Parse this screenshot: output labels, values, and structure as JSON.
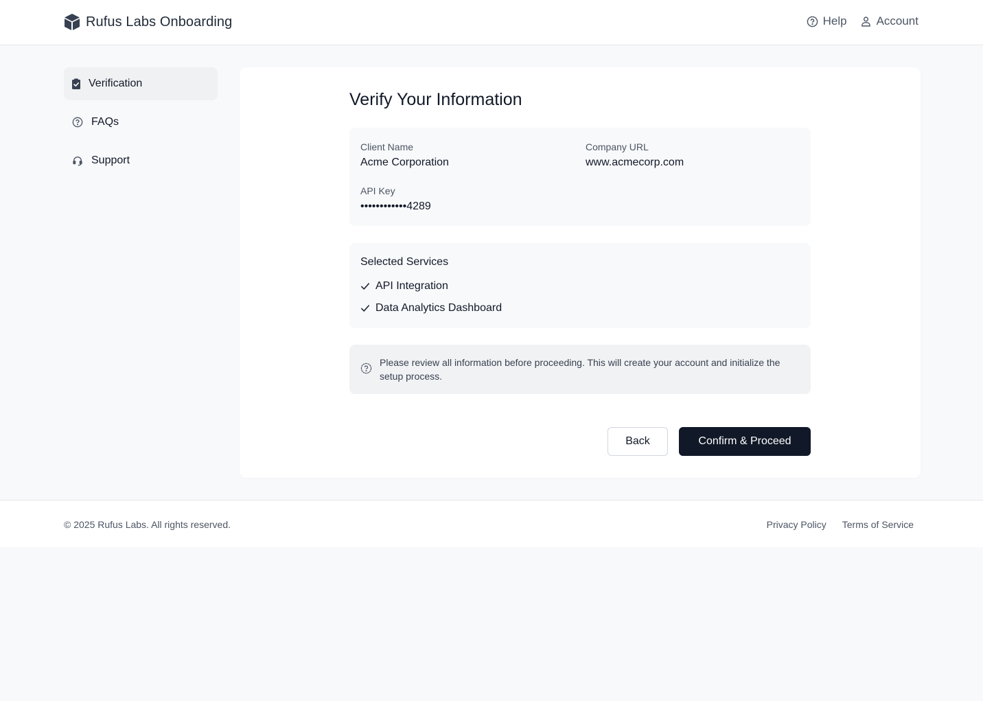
{
  "header": {
    "brand_icon": "cube-icon",
    "title": "Rufus Labs Onboarding",
    "nav": [
      {
        "label": "Help",
        "icon": "help-circle-icon"
      },
      {
        "label": "Account",
        "icon": "user-icon"
      }
    ]
  },
  "sidebar": {
    "items": [
      {
        "label": "Verification",
        "icon": "clipboard-check-icon",
        "active": true
      },
      {
        "label": "FAQs",
        "icon": "question-circle-icon",
        "active": false
      },
      {
        "label": "Support",
        "icon": "headset-icon",
        "active": false
      }
    ]
  },
  "main": {
    "title": "Verify Your Information",
    "info": {
      "client_name_label": "Client Name",
      "client_name_value": "Acme Corporation",
      "company_url_label": "Company URL",
      "company_url_value": "www.acmecorp.com",
      "api_key_label": "API Key",
      "api_key_value": "••••••••••••4289"
    },
    "services": {
      "title": "Selected Services",
      "items": [
        "API Integration",
        "Data Analytics Dashboard"
      ]
    },
    "notice": {
      "icon": "question-circle-icon",
      "text": "Please review all information before proceeding. This will create your account and initialize the setup process."
    },
    "actions": {
      "back_label": "Back",
      "confirm_label": "Confirm & Proceed"
    }
  },
  "footer": {
    "copyright": "© 2025 Rufus Labs. All rights reserved.",
    "links": [
      "Privacy Policy",
      "Terms of Service"
    ]
  },
  "colors": {
    "primary_button": "#111827",
    "page_background": "#f8f9fb",
    "panel_background": "#f8f9fb",
    "notice_background": "#f1f2f4",
    "muted_text": "#4b5563"
  }
}
